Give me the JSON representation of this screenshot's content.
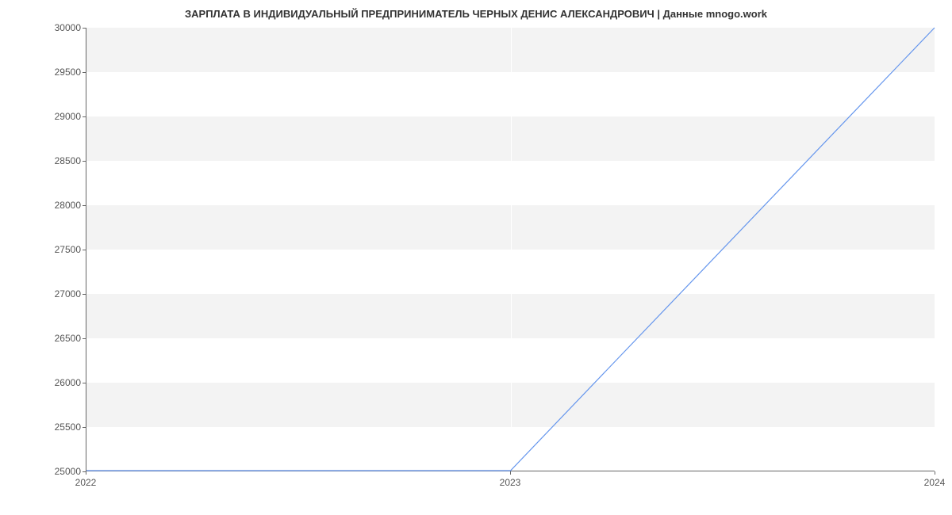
{
  "chart_data": {
    "type": "line",
    "title": "ЗАРПЛАТА В ИНДИВИДУАЛЬНЫЙ ПРЕДПРИНИМАТЕЛЬ ЧЕРНЫХ ДЕНИС АЛЕКСАНДРОВИЧ | Данные mnogo.work",
    "xlabel": "",
    "ylabel": "",
    "x_categories": [
      "2022",
      "2023",
      "2024"
    ],
    "y_ticks": [
      25000,
      25500,
      26000,
      26500,
      27000,
      27500,
      28000,
      28500,
      29000,
      29500,
      30000
    ],
    "ylim": [
      25000,
      30000
    ],
    "series": [
      {
        "name": "salary",
        "color": "#6495ED",
        "x": [
          "2022",
          "2023",
          "2024"
        ],
        "y": [
          25000,
          25000,
          30000
        ]
      }
    ],
    "grid": {
      "horizontal_bands": true,
      "vertical_lines": true
    }
  }
}
